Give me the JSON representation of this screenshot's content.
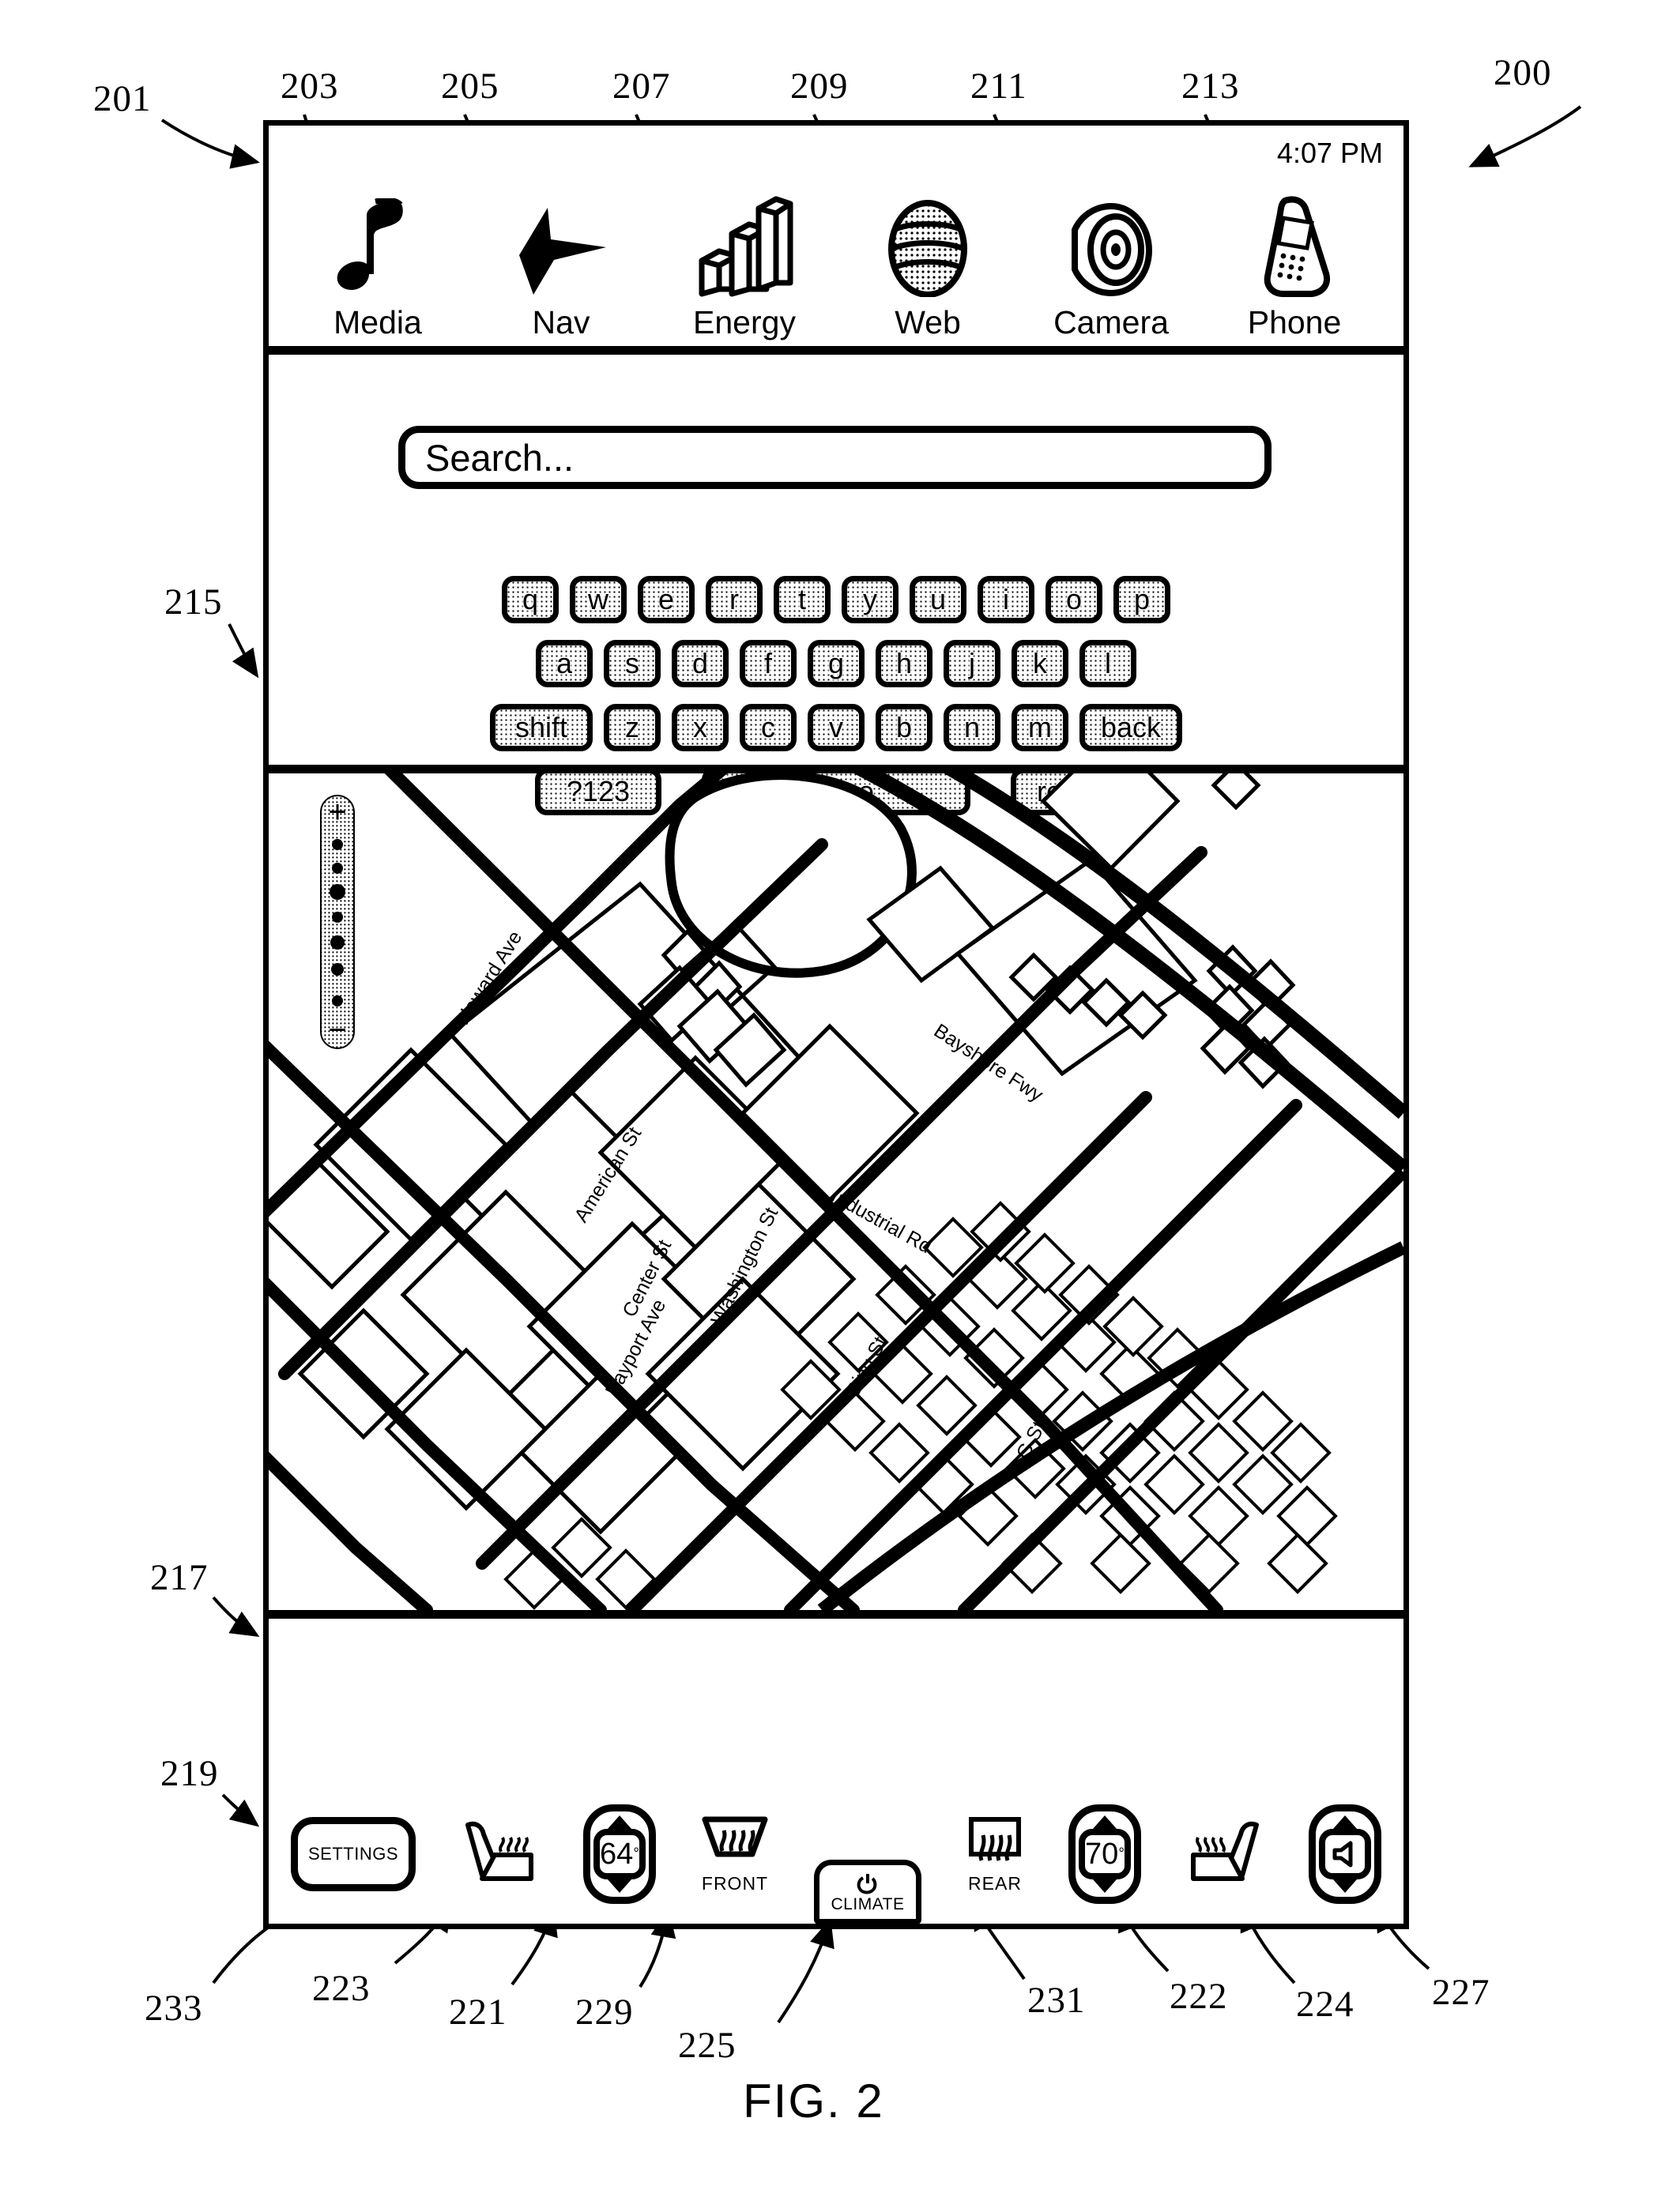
{
  "figure": {
    "label": "FIG. 2",
    "system_ref": "200"
  },
  "refs": {
    "system": "200",
    "app_bar": "201",
    "media": "203",
    "nav": "205",
    "energy": "207",
    "web": "209",
    "camera": "211",
    "phone": "213",
    "search_region": "215",
    "map_region": "217",
    "climate_region": "219",
    "temp_left": "221",
    "seat_right": "222",
    "seat_left": "223",
    "volume_stepper": "224",
    "climate_power": "225",
    "volume": "227",
    "front_defrost": "229",
    "rear_defrost": "231",
    "settings": "233"
  },
  "app_bar": {
    "clock": "4:07 PM",
    "apps": [
      {
        "label": "Media",
        "icon": "music-note-icon"
      },
      {
        "label": "Nav",
        "icon": "navigation-arrow-icon"
      },
      {
        "label": "Energy",
        "icon": "bar-chart-3d-icon"
      },
      {
        "label": "Web",
        "icon": "globe-icon"
      },
      {
        "label": "Camera",
        "icon": "camera-lens-icon"
      },
      {
        "label": "Phone",
        "icon": "mobile-phone-icon"
      }
    ]
  },
  "search": {
    "placeholder": "Search...",
    "value": ""
  },
  "keyboard": {
    "row1": [
      "q",
      "w",
      "e",
      "r",
      "t",
      "y",
      "u",
      "i",
      "o",
      "p"
    ],
    "row2": [
      "a",
      "s",
      "d",
      "f",
      "g",
      "h",
      "j",
      "k",
      "l"
    ],
    "row3": [
      "shift",
      "z",
      "x",
      "c",
      "v",
      "b",
      "n",
      "m",
      "back"
    ],
    "row4": [
      "?123",
      "space",
      "return"
    ]
  },
  "map": {
    "zoom_in": "+",
    "zoom_out": "−",
    "streets": [
      "Howard Ave",
      "American St",
      "Center St",
      "Bayport Ave",
      "Washington St",
      "Bing St",
      "Industrial Rd",
      "Bayshore Fwy",
      "G St"
    ]
  },
  "climate": {
    "settings_label": "SETTINGS",
    "seat_left_icon": "heated-seat-left-icon",
    "temp_left": "64",
    "degree": "°",
    "front_defrost_label": "FRONT",
    "climate_label": "CLIMATE",
    "climate_power_icon": "power-icon",
    "rear_defrost_label": "REAR",
    "temp_right": "70",
    "seat_right_icon": "heated-seat-right-icon",
    "volume_icon": "speaker-icon"
  }
}
